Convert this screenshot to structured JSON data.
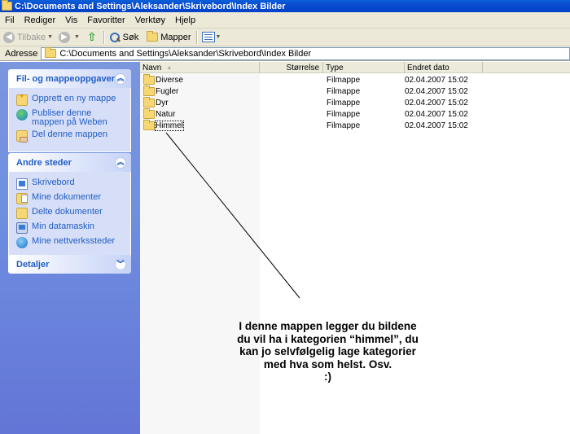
{
  "window": {
    "title": "C:\\Documents and Settings\\Aleksander\\Skrivebord\\Index Bilder"
  },
  "menu": [
    "Fil",
    "Rediger",
    "Vis",
    "Favoritter",
    "Verktøy",
    "Hjelp"
  ],
  "toolbar": {
    "back_label": "Tilbake",
    "search_label": "Søk",
    "folders_label": "Mapper"
  },
  "address": {
    "label": "Adresse",
    "value": "C:\\Documents and Settings\\Aleksander\\Skrivebord\\Index Bilder"
  },
  "tasks_panel": {
    "title": "Fil- og mappeoppgaver",
    "items": [
      {
        "label": "Opprett en ny mappe",
        "icon": "new-folder-icon"
      },
      {
        "label": "Publiser denne mappen på Weben",
        "icon": "publish-web-icon"
      },
      {
        "label": "Del denne mappen",
        "icon": "share-folder-icon"
      }
    ]
  },
  "places_panel": {
    "title": "Andre steder",
    "items": [
      {
        "label": "Skrivebord",
        "icon": "desktop-icon"
      },
      {
        "label": "Mine dokumenter",
        "icon": "my-documents-icon"
      },
      {
        "label": "Delte dokumenter",
        "icon": "shared-documents-icon"
      },
      {
        "label": "Min datamaskin",
        "icon": "my-computer-icon"
      },
      {
        "label": "Mine nettverkssteder",
        "icon": "network-places-icon"
      }
    ]
  },
  "details_panel": {
    "title": "Detaljer"
  },
  "columns": {
    "name": "Navn",
    "size": "Størrelse",
    "type": "Type",
    "date": "Endret dato"
  },
  "files": [
    {
      "name": "Diverse",
      "size": "",
      "type": "Filmappe",
      "date": "02.04.2007 15:02"
    },
    {
      "name": "Fugler",
      "size": "",
      "type": "Filmappe",
      "date": "02.04.2007 15:02"
    },
    {
      "name": "Dyr",
      "size": "",
      "type": "Filmappe",
      "date": "02.04.2007 15:02"
    },
    {
      "name": "Natur",
      "size": "",
      "type": "Filmappe",
      "date": "02.04.2007 15:02"
    },
    {
      "name": "Himmel",
      "size": "",
      "type": "Filmappe",
      "date": "02.04.2007 15:02"
    }
  ],
  "annotation": {
    "lines": [
      "I denne mappen legger du bildene",
      "du vil ha i kategorien “himmel”, du",
      "kan jo selvfølgelig lage kategorier",
      "med hva som helst. Osv.",
      ":)"
    ]
  }
}
